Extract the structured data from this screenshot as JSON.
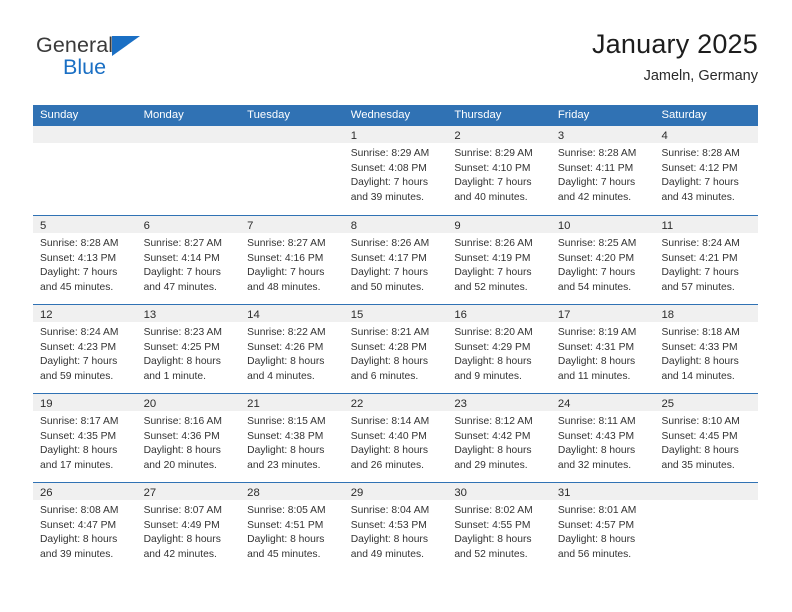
{
  "brand": {
    "word_general": "General",
    "word_blue": "Blue",
    "triangle_color": "#1a6fc4"
  },
  "header": {
    "title": "January 2025",
    "subtitle": "Jameln, Germany"
  },
  "theme": {
    "header_blue": "#3072b4",
    "day_band_gray": "#f0f0f0",
    "text": "#333333"
  },
  "weekdays": [
    "Sunday",
    "Monday",
    "Tuesday",
    "Wednesday",
    "Thursday",
    "Friday",
    "Saturday"
  ],
  "weeks": [
    [
      {
        "num": "",
        "lines": [],
        "empty": true
      },
      {
        "num": "",
        "lines": [],
        "empty": true
      },
      {
        "num": "",
        "lines": [],
        "empty": true
      },
      {
        "num": "1",
        "lines": [
          "Sunrise: 8:29 AM",
          "Sunset: 4:08 PM",
          "Daylight: 7 hours",
          "and 39 minutes."
        ]
      },
      {
        "num": "2",
        "lines": [
          "Sunrise: 8:29 AM",
          "Sunset: 4:10 PM",
          "Daylight: 7 hours",
          "and 40 minutes."
        ]
      },
      {
        "num": "3",
        "lines": [
          "Sunrise: 8:28 AM",
          "Sunset: 4:11 PM",
          "Daylight: 7 hours",
          "and 42 minutes."
        ]
      },
      {
        "num": "4",
        "lines": [
          "Sunrise: 8:28 AM",
          "Sunset: 4:12 PM",
          "Daylight: 7 hours",
          "and 43 minutes."
        ]
      }
    ],
    [
      {
        "num": "5",
        "lines": [
          "Sunrise: 8:28 AM",
          "Sunset: 4:13 PM",
          "Daylight: 7 hours",
          "and 45 minutes."
        ]
      },
      {
        "num": "6",
        "lines": [
          "Sunrise: 8:27 AM",
          "Sunset: 4:14 PM",
          "Daylight: 7 hours",
          "and 47 minutes."
        ]
      },
      {
        "num": "7",
        "lines": [
          "Sunrise: 8:27 AM",
          "Sunset: 4:16 PM",
          "Daylight: 7 hours",
          "and 48 minutes."
        ]
      },
      {
        "num": "8",
        "lines": [
          "Sunrise: 8:26 AM",
          "Sunset: 4:17 PM",
          "Daylight: 7 hours",
          "and 50 minutes."
        ]
      },
      {
        "num": "9",
        "lines": [
          "Sunrise: 8:26 AM",
          "Sunset: 4:19 PM",
          "Daylight: 7 hours",
          "and 52 minutes."
        ]
      },
      {
        "num": "10",
        "lines": [
          "Sunrise: 8:25 AM",
          "Sunset: 4:20 PM",
          "Daylight: 7 hours",
          "and 54 minutes."
        ]
      },
      {
        "num": "11",
        "lines": [
          "Sunrise: 8:24 AM",
          "Sunset: 4:21 PM",
          "Daylight: 7 hours",
          "and 57 minutes."
        ]
      }
    ],
    [
      {
        "num": "12",
        "lines": [
          "Sunrise: 8:24 AM",
          "Sunset: 4:23 PM",
          "Daylight: 7 hours",
          "and 59 minutes."
        ]
      },
      {
        "num": "13",
        "lines": [
          "Sunrise: 8:23 AM",
          "Sunset: 4:25 PM",
          "Daylight: 8 hours",
          "and 1 minute."
        ]
      },
      {
        "num": "14",
        "lines": [
          "Sunrise: 8:22 AM",
          "Sunset: 4:26 PM",
          "Daylight: 8 hours",
          "and 4 minutes."
        ]
      },
      {
        "num": "15",
        "lines": [
          "Sunrise: 8:21 AM",
          "Sunset: 4:28 PM",
          "Daylight: 8 hours",
          "and 6 minutes."
        ]
      },
      {
        "num": "16",
        "lines": [
          "Sunrise: 8:20 AM",
          "Sunset: 4:29 PM",
          "Daylight: 8 hours",
          "and 9 minutes."
        ]
      },
      {
        "num": "17",
        "lines": [
          "Sunrise: 8:19 AM",
          "Sunset: 4:31 PM",
          "Daylight: 8 hours",
          "and 11 minutes."
        ]
      },
      {
        "num": "18",
        "lines": [
          "Sunrise: 8:18 AM",
          "Sunset: 4:33 PM",
          "Daylight: 8 hours",
          "and 14 minutes."
        ]
      }
    ],
    [
      {
        "num": "19",
        "lines": [
          "Sunrise: 8:17 AM",
          "Sunset: 4:35 PM",
          "Daylight: 8 hours",
          "and 17 minutes."
        ]
      },
      {
        "num": "20",
        "lines": [
          "Sunrise: 8:16 AM",
          "Sunset: 4:36 PM",
          "Daylight: 8 hours",
          "and 20 minutes."
        ]
      },
      {
        "num": "21",
        "lines": [
          "Sunrise: 8:15 AM",
          "Sunset: 4:38 PM",
          "Daylight: 8 hours",
          "and 23 minutes."
        ]
      },
      {
        "num": "22",
        "lines": [
          "Sunrise: 8:14 AM",
          "Sunset: 4:40 PM",
          "Daylight: 8 hours",
          "and 26 minutes."
        ]
      },
      {
        "num": "23",
        "lines": [
          "Sunrise: 8:12 AM",
          "Sunset: 4:42 PM",
          "Daylight: 8 hours",
          "and 29 minutes."
        ]
      },
      {
        "num": "24",
        "lines": [
          "Sunrise: 8:11 AM",
          "Sunset: 4:43 PM",
          "Daylight: 8 hours",
          "and 32 minutes."
        ]
      },
      {
        "num": "25",
        "lines": [
          "Sunrise: 8:10 AM",
          "Sunset: 4:45 PM",
          "Daylight: 8 hours",
          "and 35 minutes."
        ]
      }
    ],
    [
      {
        "num": "26",
        "lines": [
          "Sunrise: 8:08 AM",
          "Sunset: 4:47 PM",
          "Daylight: 8 hours",
          "and 39 minutes."
        ]
      },
      {
        "num": "27",
        "lines": [
          "Sunrise: 8:07 AM",
          "Sunset: 4:49 PM",
          "Daylight: 8 hours",
          "and 42 minutes."
        ]
      },
      {
        "num": "28",
        "lines": [
          "Sunrise: 8:05 AM",
          "Sunset: 4:51 PM",
          "Daylight: 8 hours",
          "and 45 minutes."
        ]
      },
      {
        "num": "29",
        "lines": [
          "Sunrise: 8:04 AM",
          "Sunset: 4:53 PM",
          "Daylight: 8 hours",
          "and 49 minutes."
        ]
      },
      {
        "num": "30",
        "lines": [
          "Sunrise: 8:02 AM",
          "Sunset: 4:55 PM",
          "Daylight: 8 hours",
          "and 52 minutes."
        ]
      },
      {
        "num": "31",
        "lines": [
          "Sunrise: 8:01 AM",
          "Sunset: 4:57 PM",
          "Daylight: 8 hours",
          "and 56 minutes."
        ]
      },
      {
        "num": "",
        "lines": [],
        "empty": true
      }
    ]
  ]
}
